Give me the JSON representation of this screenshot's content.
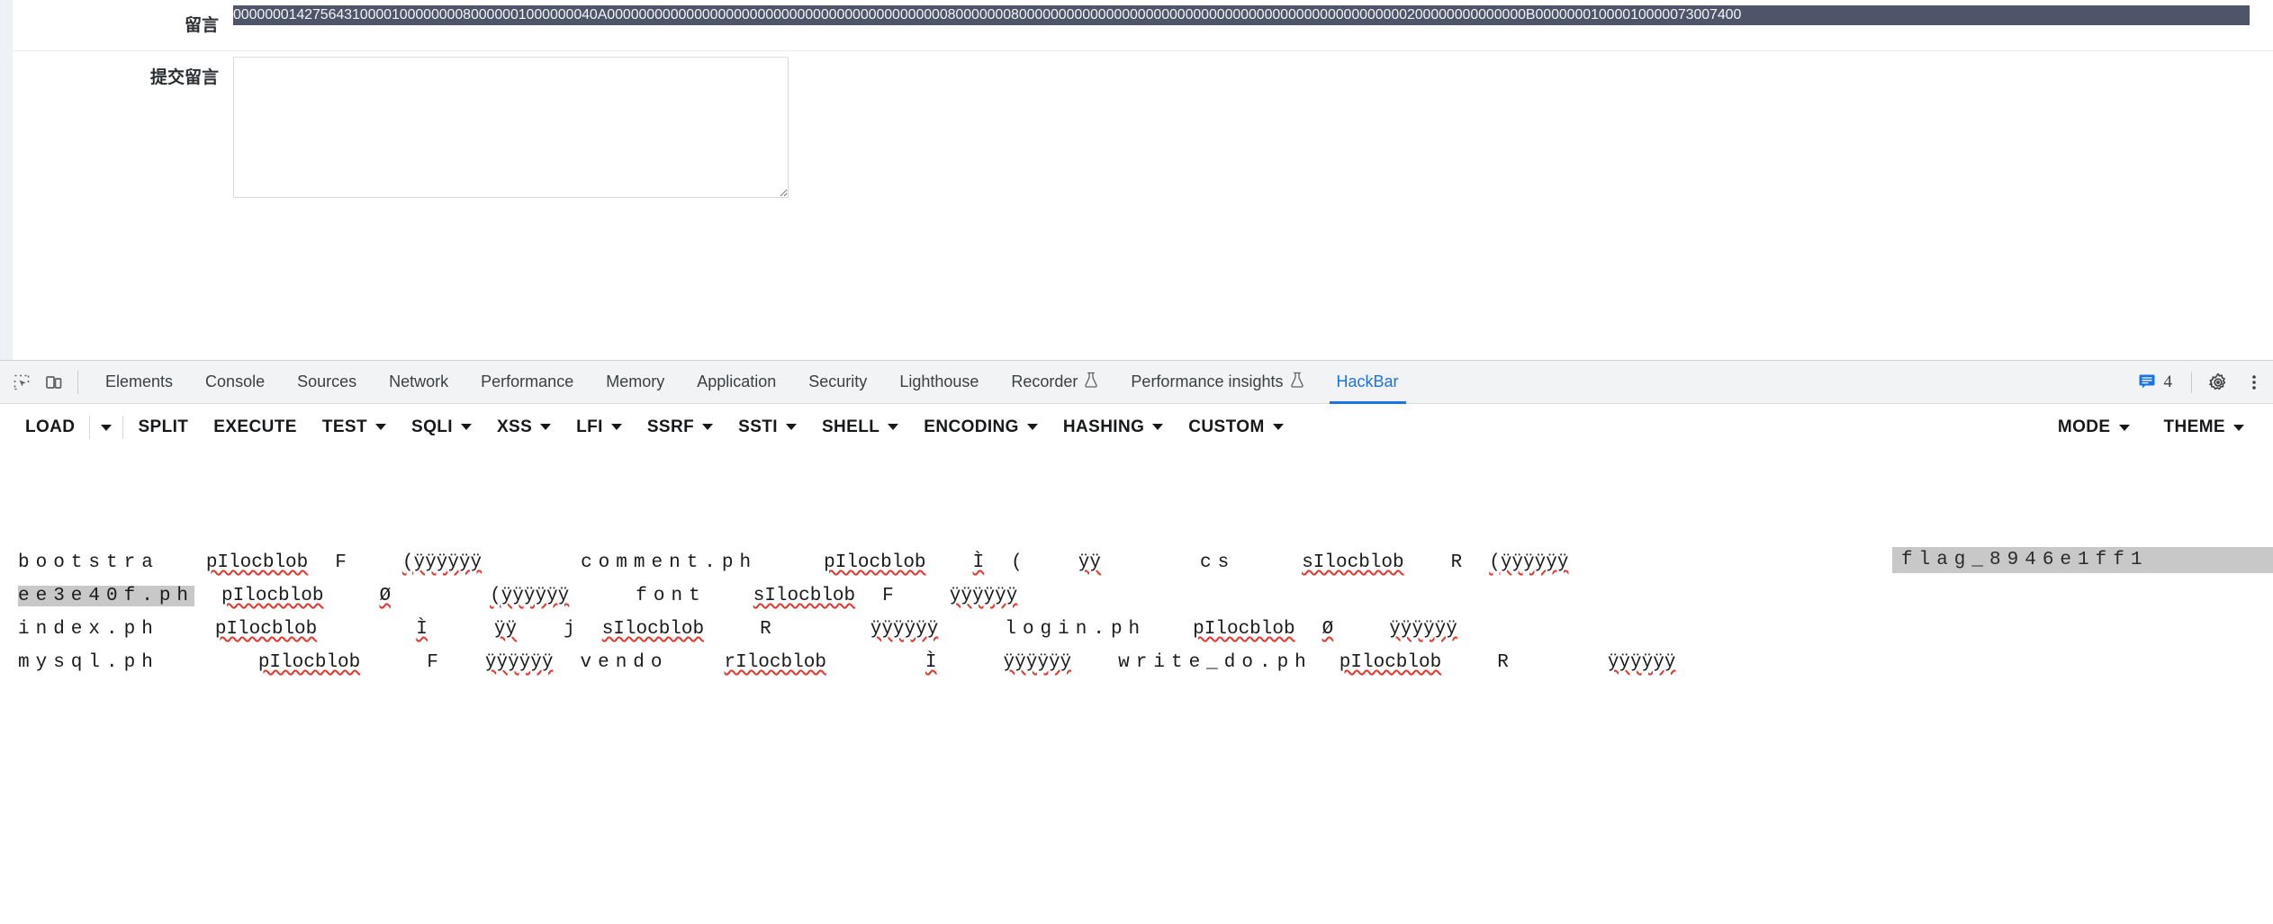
{
  "page": {
    "comment_field": {
      "label": "留言",
      "value": "0000000142756431000010000000080000001000000040A00000000000000000000000000000000000000000008000000080000000000000000000000000000000000000000000000000200000000000000B00000001000010000073007400"
    },
    "submit_field": {
      "label": "提交留言",
      "textarea_value": "",
      "textarea_placeholder": ""
    }
  },
  "devtools": {
    "icons": {
      "inspect": "inspect-element-icon",
      "device": "device-toolbar-icon",
      "messages": "message-icon",
      "settings": "gear-icon",
      "more": "more-vertical-icon"
    },
    "message_count": "4",
    "tabs": [
      {
        "label": "Elements",
        "active": false,
        "beaker": false
      },
      {
        "label": "Console",
        "active": false,
        "beaker": false
      },
      {
        "label": "Sources",
        "active": false,
        "beaker": false
      },
      {
        "label": "Network",
        "active": false,
        "beaker": false
      },
      {
        "label": "Performance",
        "active": false,
        "beaker": false
      },
      {
        "label": "Memory",
        "active": false,
        "beaker": false
      },
      {
        "label": "Application",
        "active": false,
        "beaker": false
      },
      {
        "label": "Security",
        "active": false,
        "beaker": false
      },
      {
        "label": "Lighthouse",
        "active": false,
        "beaker": false
      },
      {
        "label": "Recorder",
        "active": false,
        "beaker": true
      },
      {
        "label": "Performance insights",
        "active": false,
        "beaker": true
      },
      {
        "label": "HackBar",
        "active": true,
        "beaker": false
      }
    ],
    "accent_color": "#1a73e8"
  },
  "hackbar": {
    "buttons": [
      {
        "label": "LOAD",
        "caret": false,
        "separate_caret": true
      },
      {
        "label": "SPLIT",
        "caret": false,
        "separate_caret": false
      },
      {
        "label": "EXECUTE",
        "caret": false,
        "separate_caret": false
      },
      {
        "label": "TEST",
        "caret": true,
        "separate_caret": false
      },
      {
        "label": "SQLI",
        "caret": true,
        "separate_caret": false
      },
      {
        "label": "XSS",
        "caret": true,
        "separate_caret": false
      },
      {
        "label": "LFI",
        "caret": true,
        "separate_caret": false
      },
      {
        "label": "SSRF",
        "caret": true,
        "separate_caret": false
      },
      {
        "label": "SSTI",
        "caret": true,
        "separate_caret": false
      },
      {
        "label": "SHELL",
        "caret": true,
        "separate_caret": false
      },
      {
        "label": "ENCODING",
        "caret": true,
        "separate_caret": false
      },
      {
        "label": "HASHING",
        "caret": true,
        "separate_caret": false
      },
      {
        "label": "CUSTOM",
        "caret": true,
        "separate_caret": false
      }
    ],
    "right_buttons": [
      {
        "label": "MODE",
        "caret": true
      },
      {
        "label": "THEME",
        "caret": true
      }
    ]
  },
  "output": {
    "flag_chip": "flag_8946e1ff1",
    "rows": [
      {
        "cells": [
          {
            "text": "bootstra",
            "spaced": true,
            "misspell": false,
            "highlight": false
          },
          {
            "text": "pIlocblob",
            "spaced": false,
            "misspell": true,
            "highlight": false
          },
          {
            "text": "F",
            "spaced": false,
            "misspell": false,
            "highlight": false
          },
          {
            "text": "(ÿÿÿÿÿÿ",
            "spaced": false,
            "misspell": true,
            "highlight": false
          },
          {
            "text": "comment.ph",
            "spaced": true,
            "misspell": false,
            "highlight": false
          },
          {
            "text": "pIlocblob",
            "spaced": false,
            "misspell": true,
            "highlight": false
          },
          {
            "text": "Ì",
            "spaced": false,
            "misspell": true,
            "highlight": false
          },
          {
            "text": "(",
            "spaced": false,
            "misspell": false,
            "highlight": false
          },
          {
            "text": "ÿÿ",
            "spaced": false,
            "misspell": true,
            "highlight": false
          },
          {
            "text": "cs",
            "spaced": true,
            "misspell": false,
            "highlight": false
          },
          {
            "text": "sIlocblob",
            "spaced": false,
            "misspell": true,
            "highlight": false
          },
          {
            "text": "R",
            "spaced": false,
            "misspell": false,
            "highlight": false
          },
          {
            "text": "(ÿÿÿÿÿÿ",
            "spaced": false,
            "misspell": true,
            "highlight": false
          }
        ]
      },
      {
        "cells": [
          {
            "text": "ee3e40f.ph",
            "spaced": true,
            "misspell": false,
            "highlight": true
          },
          {
            "text": "pIlocblob",
            "spaced": false,
            "misspell": true,
            "highlight": false
          },
          {
            "text": "Ø",
            "spaced": false,
            "misspell": true,
            "highlight": false
          },
          {
            "text": "(ÿÿÿÿÿÿ",
            "spaced": false,
            "misspell": true,
            "highlight": false
          },
          {
            "text": "font",
            "spaced": true,
            "misspell": false,
            "highlight": false
          },
          {
            "text": "sIlocblob",
            "spaced": false,
            "misspell": true,
            "highlight": false
          },
          {
            "text": "F",
            "spaced": false,
            "misspell": false,
            "highlight": false
          },
          {
            "text": "ÿÿÿÿÿÿ",
            "spaced": false,
            "misspell": true,
            "highlight": false
          }
        ]
      },
      {
        "cells": [
          {
            "text": "index.ph",
            "spaced": true,
            "misspell": false,
            "highlight": false
          },
          {
            "text": "pIlocblob",
            "spaced": false,
            "misspell": true,
            "highlight": false
          },
          {
            "text": "Ì",
            "spaced": false,
            "misspell": true,
            "highlight": false
          },
          {
            "text": "ÿÿ",
            "spaced": false,
            "misspell": true,
            "highlight": false
          },
          {
            "text": "j",
            "spaced": false,
            "misspell": false,
            "highlight": false
          },
          {
            "text": "sIlocblob",
            "spaced": false,
            "misspell": true,
            "highlight": false
          },
          {
            "text": "R",
            "spaced": false,
            "misspell": false,
            "highlight": false
          },
          {
            "text": "ÿÿÿÿÿÿ",
            "spaced": false,
            "misspell": true,
            "highlight": false
          },
          {
            "text": "login.ph",
            "spaced": true,
            "misspell": false,
            "highlight": false
          },
          {
            "text": "pIlocblob",
            "spaced": false,
            "misspell": true,
            "highlight": false
          },
          {
            "text": "Ø",
            "spaced": false,
            "misspell": true,
            "highlight": false
          },
          {
            "text": "ÿÿÿÿÿÿ",
            "spaced": false,
            "misspell": true,
            "highlight": false
          }
        ]
      },
      {
        "cells": [
          {
            "text": "mysql.ph",
            "spaced": true,
            "misspell": false,
            "highlight": false
          },
          {
            "text": "pIlocblob",
            "spaced": false,
            "misspell": true,
            "highlight": false
          },
          {
            "text": "F",
            "spaced": false,
            "misspell": false,
            "highlight": false
          },
          {
            "text": "ÿÿÿÿÿÿ",
            "spaced": false,
            "misspell": true,
            "highlight": false
          },
          {
            "text": "vendo",
            "spaced": true,
            "misspell": false,
            "highlight": false
          },
          {
            "text": "rIlocblob",
            "spaced": false,
            "misspell": true,
            "highlight": false
          },
          {
            "text": "Ì",
            "spaced": false,
            "misspell": true,
            "highlight": false
          },
          {
            "text": "ÿÿÿÿÿÿ",
            "spaced": false,
            "misspell": true,
            "highlight": false
          },
          {
            "text": "write_do.ph",
            "spaced": true,
            "misspell": false,
            "highlight": false
          },
          {
            "text": "pIlocblob",
            "spaced": false,
            "misspell": true,
            "highlight": false
          },
          {
            "text": "R",
            "spaced": false,
            "misspell": false,
            "highlight": false
          },
          {
            "text": "ÿÿÿÿÿÿ",
            "spaced": false,
            "misspell": true,
            "highlight": false
          }
        ]
      }
    ]
  }
}
